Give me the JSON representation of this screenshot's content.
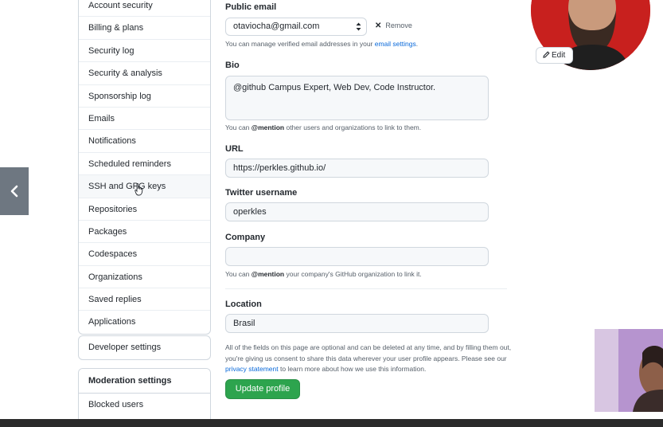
{
  "sidebar": {
    "items": [
      "Account security",
      "Billing & plans",
      "Security log",
      "Security & analysis",
      "Sponsorship log",
      "Emails",
      "Notifications",
      "Scheduled reminders",
      "SSH and GPG keys",
      "Repositories",
      "Packages",
      "Codespaces",
      "Organizations",
      "Saved replies",
      "Applications"
    ],
    "developer_settings": "Developer settings",
    "moderation_title": "Moderation settings",
    "moderation_items": [
      "Blocked users"
    ]
  },
  "form": {
    "public_email": {
      "label": "Public email",
      "value": "otaviocha@gmail.com",
      "remove_label": "Remove",
      "note_prefix": "You can manage verified email addresses in your ",
      "note_link": "email settings",
      "note_suffix": "."
    },
    "bio": {
      "label": "Bio",
      "value": "@github Campus Expert, Web Dev, Code Instructor.",
      "note_prefix": "You can ",
      "note_mention": "@mention",
      "note_suffix": " other users and organizations to link to them."
    },
    "url": {
      "label": "URL",
      "value": "https://perkles.github.io/"
    },
    "twitter": {
      "label": "Twitter username",
      "value": "operkles"
    },
    "company": {
      "label": "Company",
      "value": "",
      "note_prefix": "You can ",
      "note_mention": "@mention",
      "note_suffix": " your company's GitHub organization to link it."
    },
    "location": {
      "label": "Location",
      "value": "Brasil"
    },
    "legal_1": "All of the fields on this page are optional and can be deleted at any time, and by filling them out, you're giving us consent to share this data wherever your user profile appears. Please see our ",
    "legal_link": "privacy statement",
    "legal_2": " to learn more about how we use this information.",
    "submit_label": "Update profile"
  },
  "avatar": {
    "edit_label": "Edit"
  },
  "colors": {
    "primary_button": "#2da44e",
    "link": "#0969da",
    "avatar_background": "#c8201e"
  }
}
